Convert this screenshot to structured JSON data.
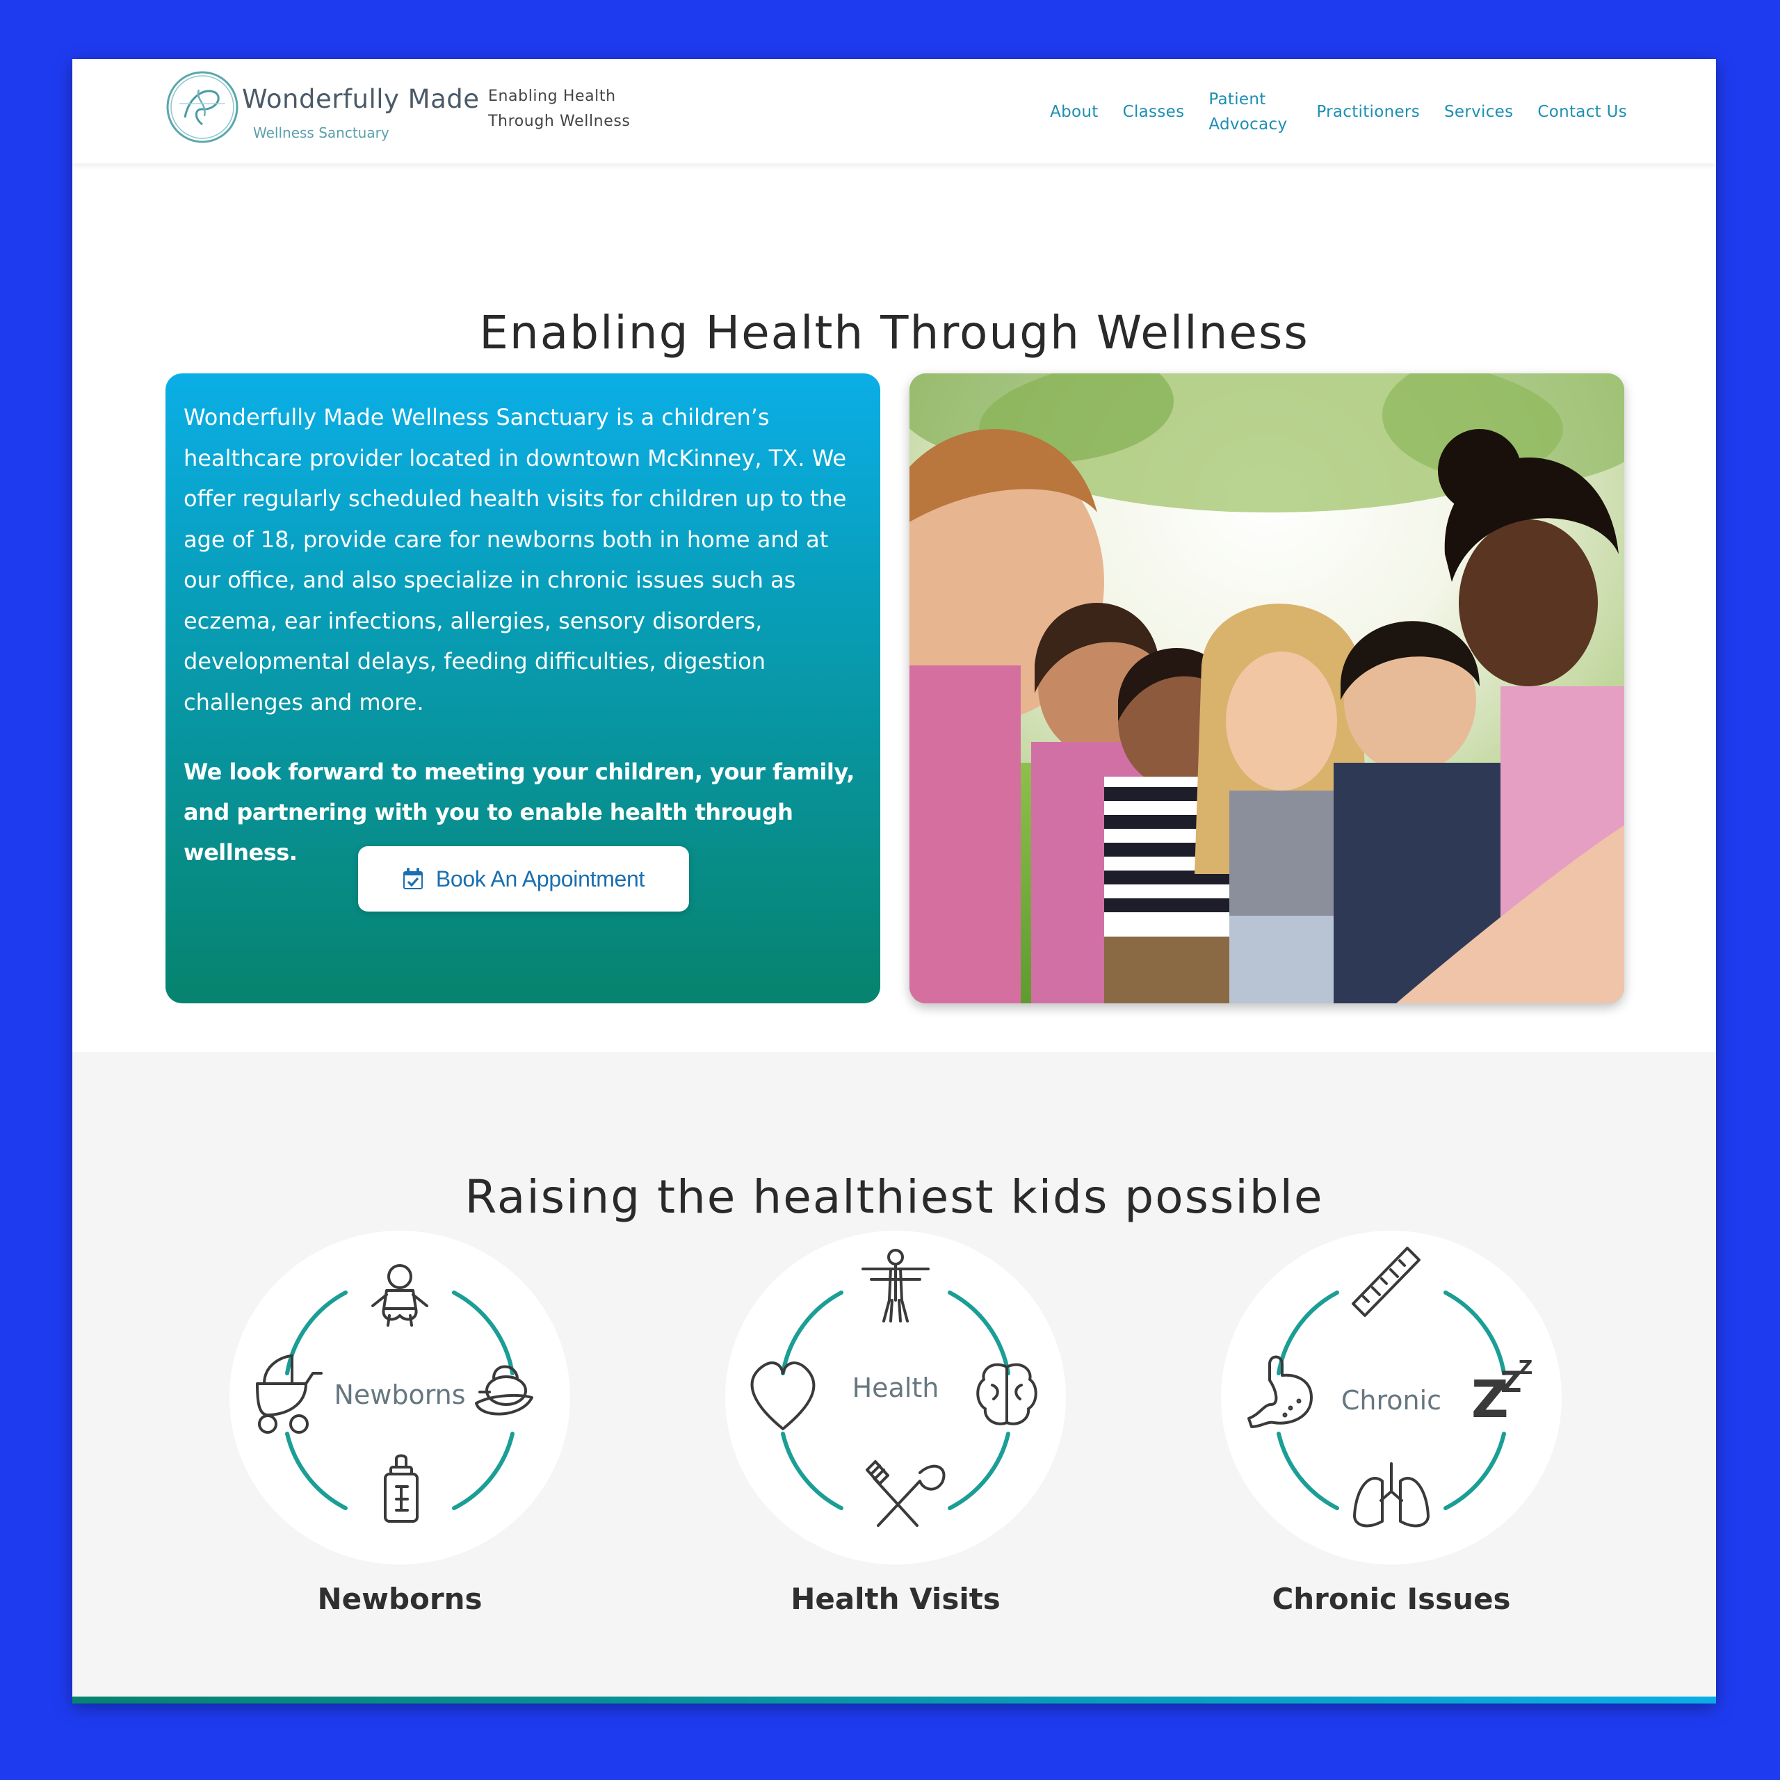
{
  "header": {
    "logo": {
      "name": "Wonderfully Made",
      "subtitle": "Wellness Sanctuary"
    },
    "tagline": [
      "Enabling Health",
      "Through Wellness"
    ],
    "nav": [
      {
        "label": "About",
        "icon": ""
      },
      {
        "label": "Classes",
        "icon": ""
      },
      {
        "label": "Patient Advocacy",
        "icon": ""
      },
      {
        "label": "Practitioners",
        "icon": ""
      },
      {
        "label": "Services",
        "icon": ""
      },
      {
        "label": "Contact Us",
        "icon": ""
      }
    ]
  },
  "hero": {
    "title": "Enabling Health Through Wellness",
    "description": "Wonderfully Made Wellness Sanctuary is a children’s healthcare provider located in downtown McKinney, TX. We offer regularly scheduled health visits for children up to the age of 18, provide care for newborns both in home and at our office, and also specialize in chronic issues such as eczema, ear infections, allergies, sensory disorders, developmental delays, feeding difficulties, digestion challenges and more.",
    "closing": "We look forward to meeting your children, your family, and partnering with you to enable health through wellness.",
    "cta": {
      "label": "Book An Appointment",
      "icon": "calendar-check-icon"
    },
    "photo_icon": "group-of-smiling-children-photo"
  },
  "services": {
    "title": "Raising the healthiest kids possible",
    "items": [
      {
        "center_label": "Newborns",
        "title": "Newborns",
        "icons": [
          "baby-icon",
          "stroller-icon",
          "pacifier-icon",
          "baby-bottle-icon"
        ]
      },
      {
        "center_label": "Health",
        "title": "Health Visits",
        "icons": [
          "vitruvian-man-icon",
          "heart-icon",
          "brain-icon",
          "fork-spoon-icon"
        ]
      },
      {
        "center_label": "Chronic",
        "title": "Chronic Issues",
        "icons": [
          "ruler-icon",
          "stomach-icon",
          "sleep-zzz-icon",
          "lungs-icon"
        ]
      }
    ]
  },
  "colors": {
    "nav_link": "#1d8fb3",
    "card_gradient_top": "#0aaee6",
    "card_gradient_bottom": "#07836e",
    "ring_accent": "#1a9e95",
    "page_border": "#1f3bf0"
  }
}
